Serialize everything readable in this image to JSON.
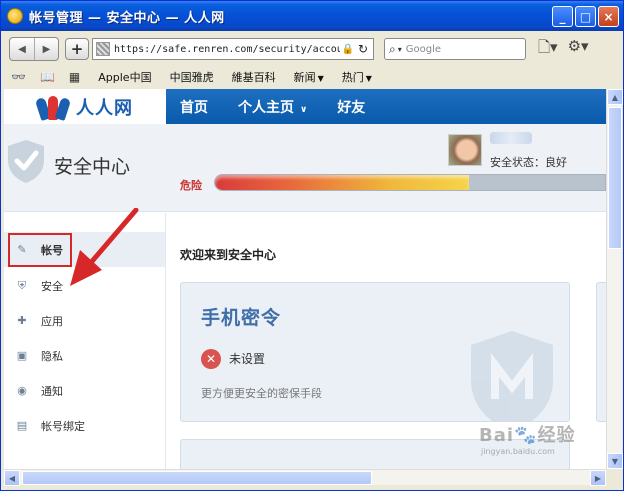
{
  "window": {
    "title": "帐号管理 — 安全中心 — 人人网",
    "buttons": {
      "minimize": "_",
      "maximize": "□",
      "close": "×"
    }
  },
  "toolbar": {
    "url": "https://safe.renren.com/security/accou",
    "search_placeholder": "Google",
    "new_tab_label": "+"
  },
  "bookmarks": {
    "items": [
      {
        "label": "Apple中国",
        "dropdown": false
      },
      {
        "label": "中国雅虎",
        "dropdown": false
      },
      {
        "label": "維基百科",
        "dropdown": false
      },
      {
        "label": "新闻",
        "dropdown": true
      },
      {
        "label": "热门",
        "dropdown": true
      }
    ]
  },
  "site": {
    "logo_text": "人人网",
    "nav": [
      {
        "label": "首页",
        "dropdown": false
      },
      {
        "label": "个人主页",
        "dropdown": true
      },
      {
        "label": "好友",
        "dropdown": false
      }
    ]
  },
  "banner": {
    "title": "安全中心",
    "status": "安全状态：良好",
    "risk_label": "危险",
    "meter_fraction": 0.65
  },
  "sidebar": {
    "items": [
      {
        "label": "帐号",
        "icon": "edit-icon",
        "active": true
      },
      {
        "label": "安全",
        "icon": "shield-icon",
        "active": false
      },
      {
        "label": "应用",
        "icon": "puzzle-icon",
        "active": false
      },
      {
        "label": "隐私",
        "icon": "lock-icon",
        "active": false
      },
      {
        "label": "通知",
        "icon": "speaker-icon",
        "active": false
      },
      {
        "label": "帐号绑定",
        "icon": "id-card-icon",
        "active": false
      }
    ]
  },
  "main": {
    "welcome": "欢迎来到安全中心",
    "card": {
      "title": "手机密令",
      "status": "未设置",
      "description": "更方便更安全的密保手段"
    }
  },
  "watermark": {
    "brand": "Bai",
    "brand_suffix": "经验",
    "url": "jingyan.baidu.com"
  },
  "colors": {
    "brand_blue": "#0a5aab",
    "danger": "#c83232",
    "card_title": "#3f6ea8"
  }
}
